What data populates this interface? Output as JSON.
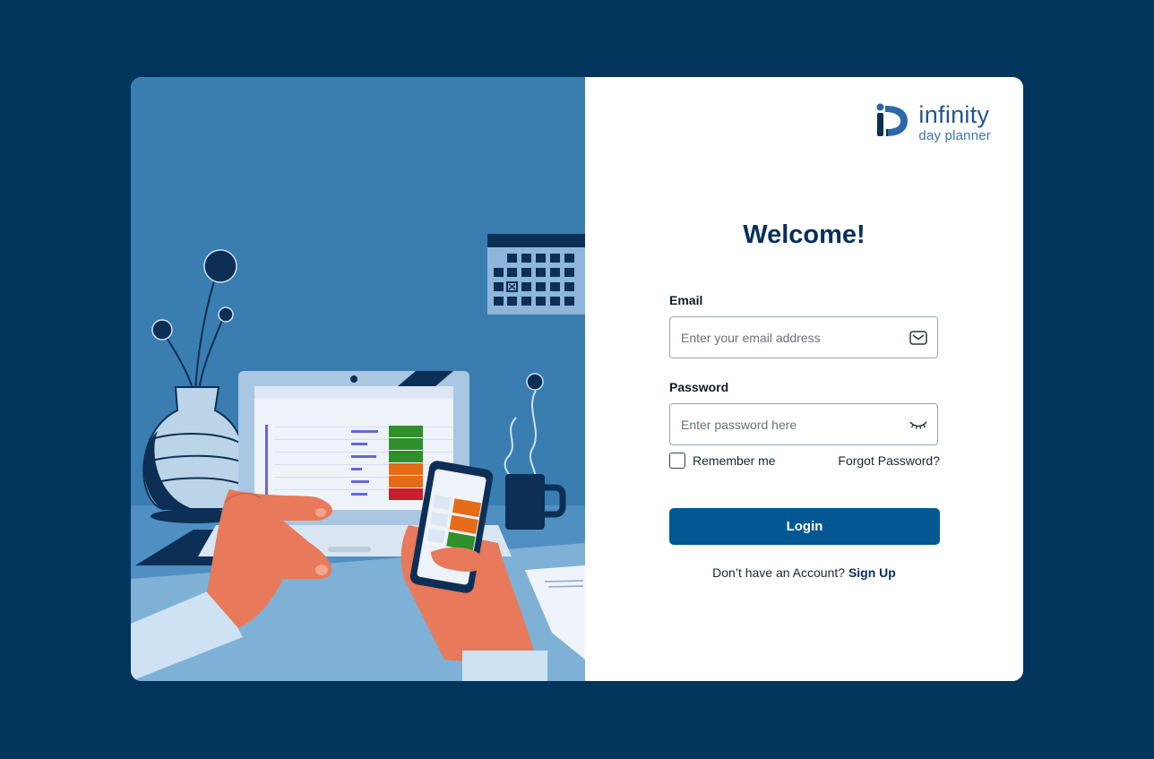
{
  "brand": {
    "name": "infinity",
    "tagline": "day planner",
    "logo_icon": "infinity-dp-logo-icon",
    "colors": {
      "primary": "#035893",
      "background": "#01355c",
      "title": "#06305a"
    }
  },
  "form": {
    "title": "Welcome!",
    "email_label": "Email",
    "email_placeholder": "Enter your email address",
    "email_icon": "envelope-icon",
    "password_label": "Password",
    "password_placeholder": "Enter password here",
    "password_icon": "eye-closed-icon",
    "remember_label": "Remember me",
    "forgot_label": "Forgot Password?",
    "login_label": "Login",
    "signup_prompt": "Don’t have an Account?",
    "signup_link": "Sign Up"
  }
}
